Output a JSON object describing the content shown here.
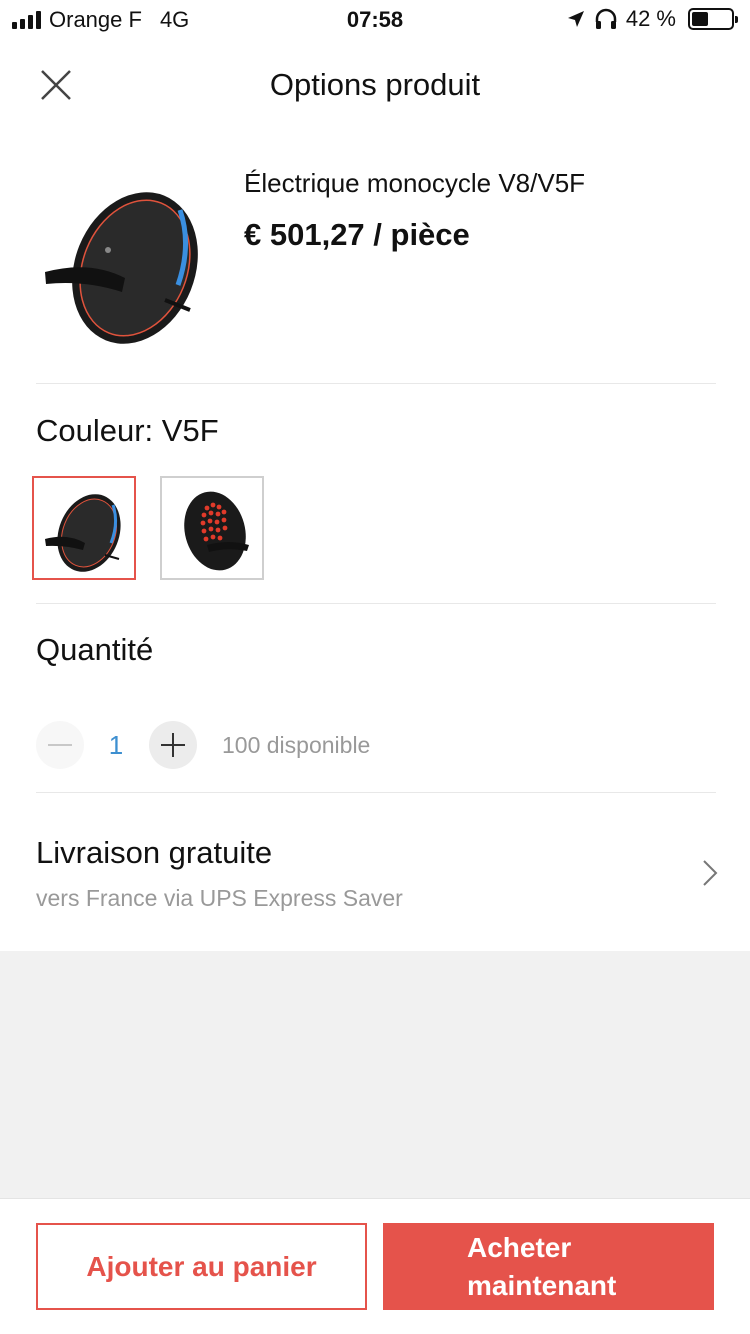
{
  "status_bar": {
    "carrier": "Orange F",
    "network": "4G",
    "time": "07:58",
    "battery": "42 %",
    "battery_level": 0.42
  },
  "header": {
    "title": "Options produit",
    "close_icon": "close-icon"
  },
  "product": {
    "name": "Électrique monocycle V8/V5F",
    "price": "€ 501,27 / pièce"
  },
  "color": {
    "label": "Couleur: V5F",
    "swatches": [
      {
        "selected": true
      },
      {
        "selected": false
      }
    ]
  },
  "quantity": {
    "label": "Quantité",
    "value": "1",
    "available": "100 disponible"
  },
  "shipping": {
    "title": "Livraison gratuite",
    "subtitle": "vers France via UPS Express Saver"
  },
  "actions": {
    "add_to_cart": "Ajouter au panier",
    "buy_now": "Acheter maintenant"
  },
  "colors": {
    "accent": "#e5534b",
    "quantity_value": "#3d8fd0"
  }
}
